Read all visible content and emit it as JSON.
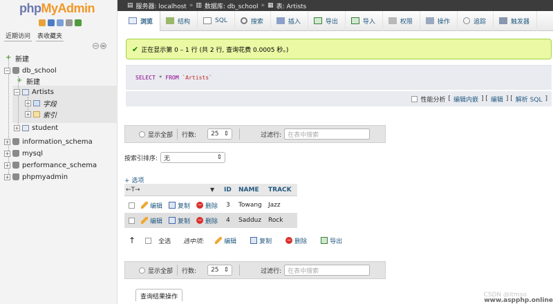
{
  "logo": {
    "php": "php",
    "myadmin": "MyAdmin"
  },
  "nav_tabs": [
    "近期访问",
    "表收藏夹"
  ],
  "tree": {
    "new_root": "新建",
    "db_school": "db_school",
    "new_child": "新建",
    "artists": "Artists",
    "fields": "字段",
    "indexes": "索引",
    "student": "student",
    "information_schema": "information_schema",
    "mysql": "mysql",
    "performance_schema": "performance_schema",
    "phpmyadmin": "phpmyadmin"
  },
  "breadcrumb": {
    "server": "服务器: localhost",
    "database": "数据库: db_school",
    "table": "表: Artists"
  },
  "tabs": [
    "浏览",
    "结构",
    "SQL",
    "搜索",
    "插入",
    "导出",
    "导入",
    "权限",
    "操作",
    "追踪",
    "触发器"
  ],
  "success_message": "正在显示第 0 – 1 行 (共 2 行, 查询花费 0.0005 秒。)",
  "sql": {
    "select": "SELECT",
    "star": "*",
    "from": "FROM",
    "table": "`Artists`"
  },
  "sql_actions": {
    "profiling": "性能分析",
    "edit_inline": "编辑内嵌",
    "edit": "编辑",
    "explain": "解析 SQL"
  },
  "navbar": {
    "show_all": "显示全部",
    "rows_label": "行数:",
    "rows_value": "25",
    "filter_label": "过滤行:",
    "filter_placeholder": "在表中搜索"
  },
  "sort": {
    "label": "按索引排序:",
    "value": "无"
  },
  "options_link": "+ 选项",
  "table": {
    "col_arrows": "←T→",
    "headers": [
      "ID",
      "NAME",
      "TRACK"
    ],
    "action_labels": {
      "edit": "编辑",
      "copy": "复制",
      "delete": "删除"
    },
    "rows": [
      {
        "id": "3",
        "name": "Towang",
        "track": "Jazz"
      },
      {
        "id": "4",
        "name": "Sadduz",
        "track": "Rock"
      }
    ]
  },
  "with_selected": {
    "check_all": "全选",
    "label": "选中项:",
    "edit": "编辑",
    "copy": "复制",
    "delete": "删除",
    "export": "导出"
  },
  "query_results_ops": "查询结果操作",
  "watermark": {
    "csdn": "CSDN @itmso",
    "site": "www.aspphp.online"
  }
}
